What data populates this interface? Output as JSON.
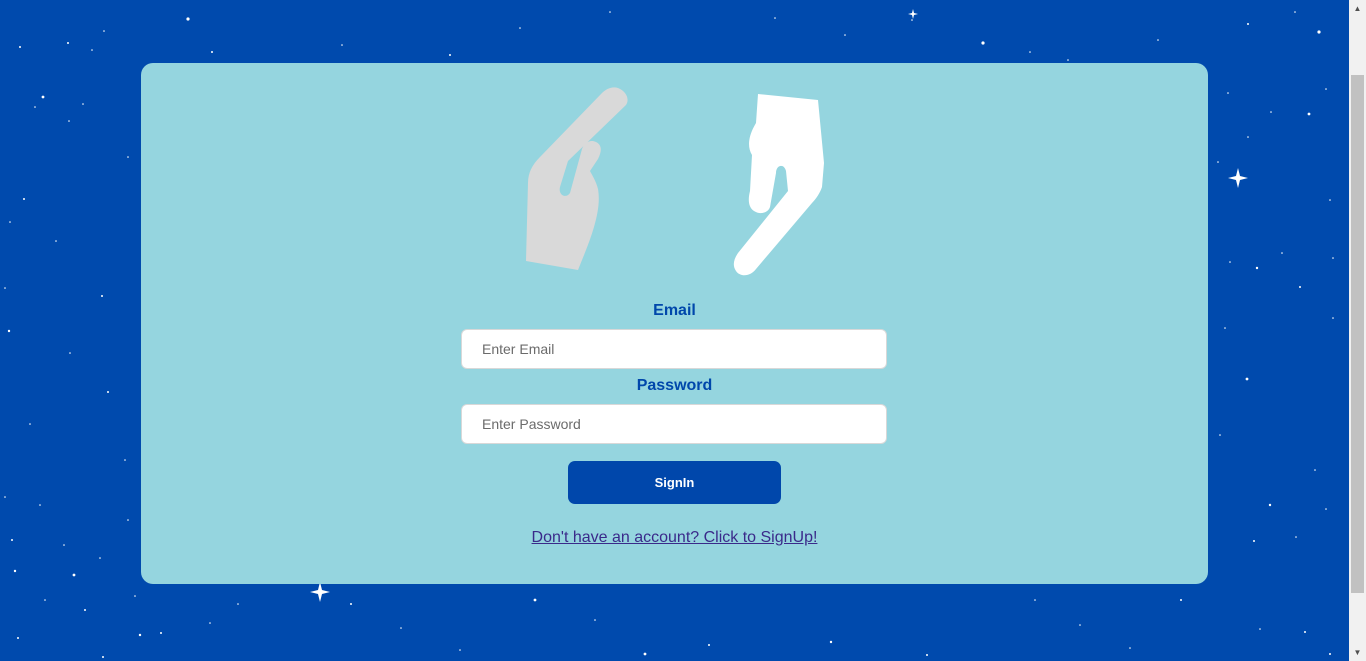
{
  "form": {
    "email_label": "Email",
    "email_placeholder": "Enter Email",
    "password_label": "Password",
    "password_placeholder": "Enter Password",
    "signin_label": "SignIn",
    "signup_link": "Don't have an account? Click to SignUp!"
  },
  "icons": {
    "illustration": "hands-icon",
    "scroll_up": "scroll-up-arrow-icon",
    "scroll_down": "scroll-down-arrow-icon"
  },
  "colors": {
    "background": "#004aad",
    "card": "#95d5df",
    "accent": "#0047ab",
    "link": "#3a2a8a",
    "hand_left": "#d9d9d9",
    "hand_right": "#ffffff"
  }
}
